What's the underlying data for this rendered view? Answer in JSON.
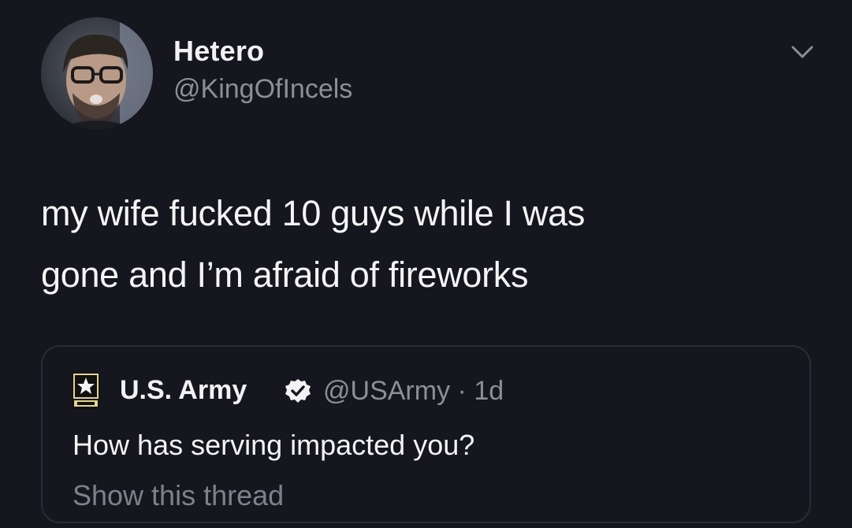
{
  "author": {
    "display_name": "Hetero",
    "handle": "@KingOfIncels"
  },
  "tweet": {
    "line1": "my wife fucked 10 guys while I was",
    "line2": "gone and I’m afraid of fireworks"
  },
  "quoted_tweet": {
    "display_name": "U.S. Army",
    "handle": "@USArmy",
    "separator": "·",
    "time": "1d",
    "text": "How has serving impacted you?",
    "show_thread": "Show this thread",
    "logo_icon": "us-army-star-logo",
    "verified_icon": "verified-badge"
  },
  "menu_icon": "chevron-down-icon",
  "colors": {
    "background": "#15161e",
    "text": "#f4f4f4",
    "secondary_text": "#8c8f96",
    "border": "#2a2c36"
  }
}
